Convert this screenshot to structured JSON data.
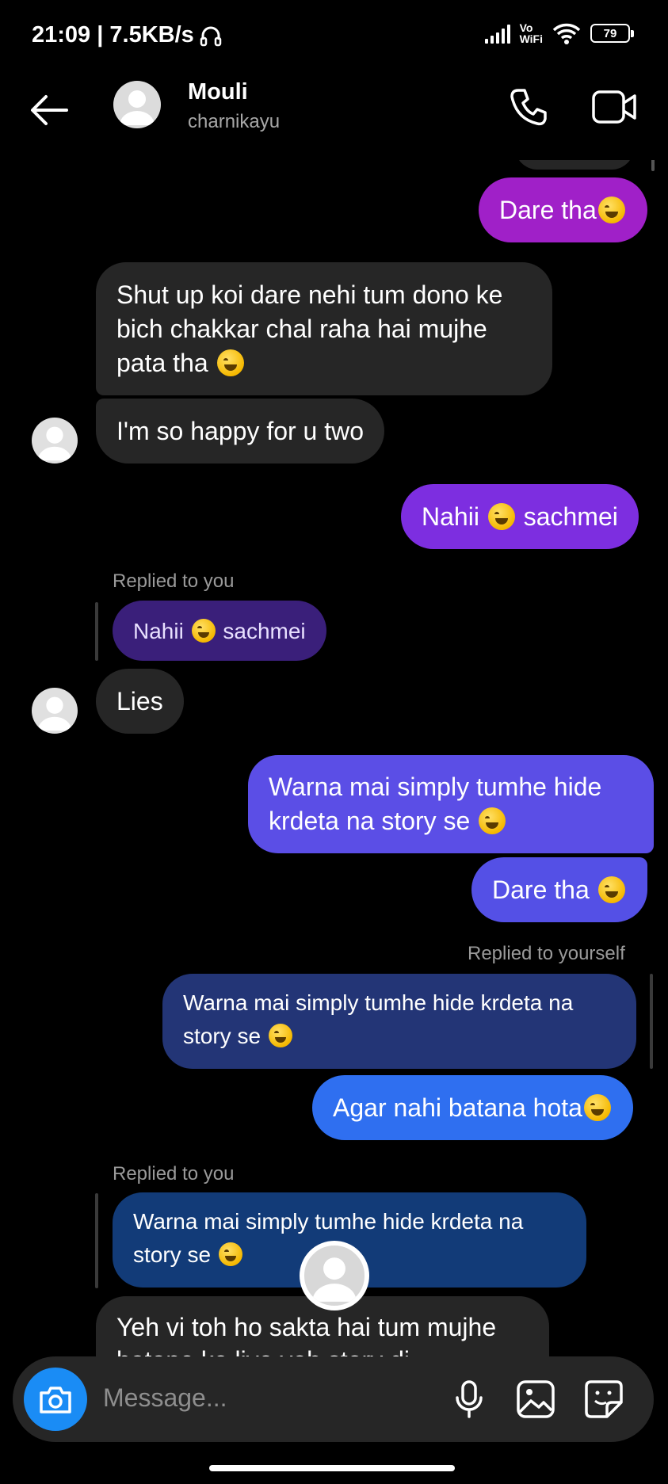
{
  "status_bar": {
    "time": "21:09 | 7.5KB/s",
    "vowifi": "Vo\nWiFi",
    "battery": "79"
  },
  "header": {
    "name": "Mouli",
    "username": "charnikayu"
  },
  "messages": {
    "m1": "Dare tha",
    "m2": "Shut up koi dare nehi tum dono ke bich chakkar chal raha hai mujhe pata tha",
    "m3": "I'm so happy for u two",
    "m4_a": "Nahii",
    "m4_b": "sachmei",
    "reply1_meta": "Replied to you",
    "reply1_quote_a": "Nahii",
    "reply1_quote_b": "sachmei",
    "m5": "Lies",
    "m6": "Warna mai simply tumhe hide krdeta na story se",
    "m7": "Dare tha",
    "reply2_meta": "Replied to yourself",
    "reply2_quote": "Warna mai simply tumhe hide krdeta na story se",
    "m8": "Agar nahi batana hota",
    "reply3_meta": "Replied to you",
    "reply3_quote": "Warna mai simply tumhe hide krdeta na story se",
    "m9_line1": "Yeh vi toh ho sakta hai tum mujhe",
    "m9_line2": "batane ke liye yeh story di"
  },
  "composer": {
    "placeholder": "Message..."
  },
  "colors": {
    "incoming": "#262626",
    "outgoing_top": "#a020c8",
    "outgoing_purple": "#7d2ee0",
    "outgoing_indigo": "#5b4ee6",
    "outgoing_blue": "#2f6ff0",
    "camera": "#1a8cf5"
  }
}
